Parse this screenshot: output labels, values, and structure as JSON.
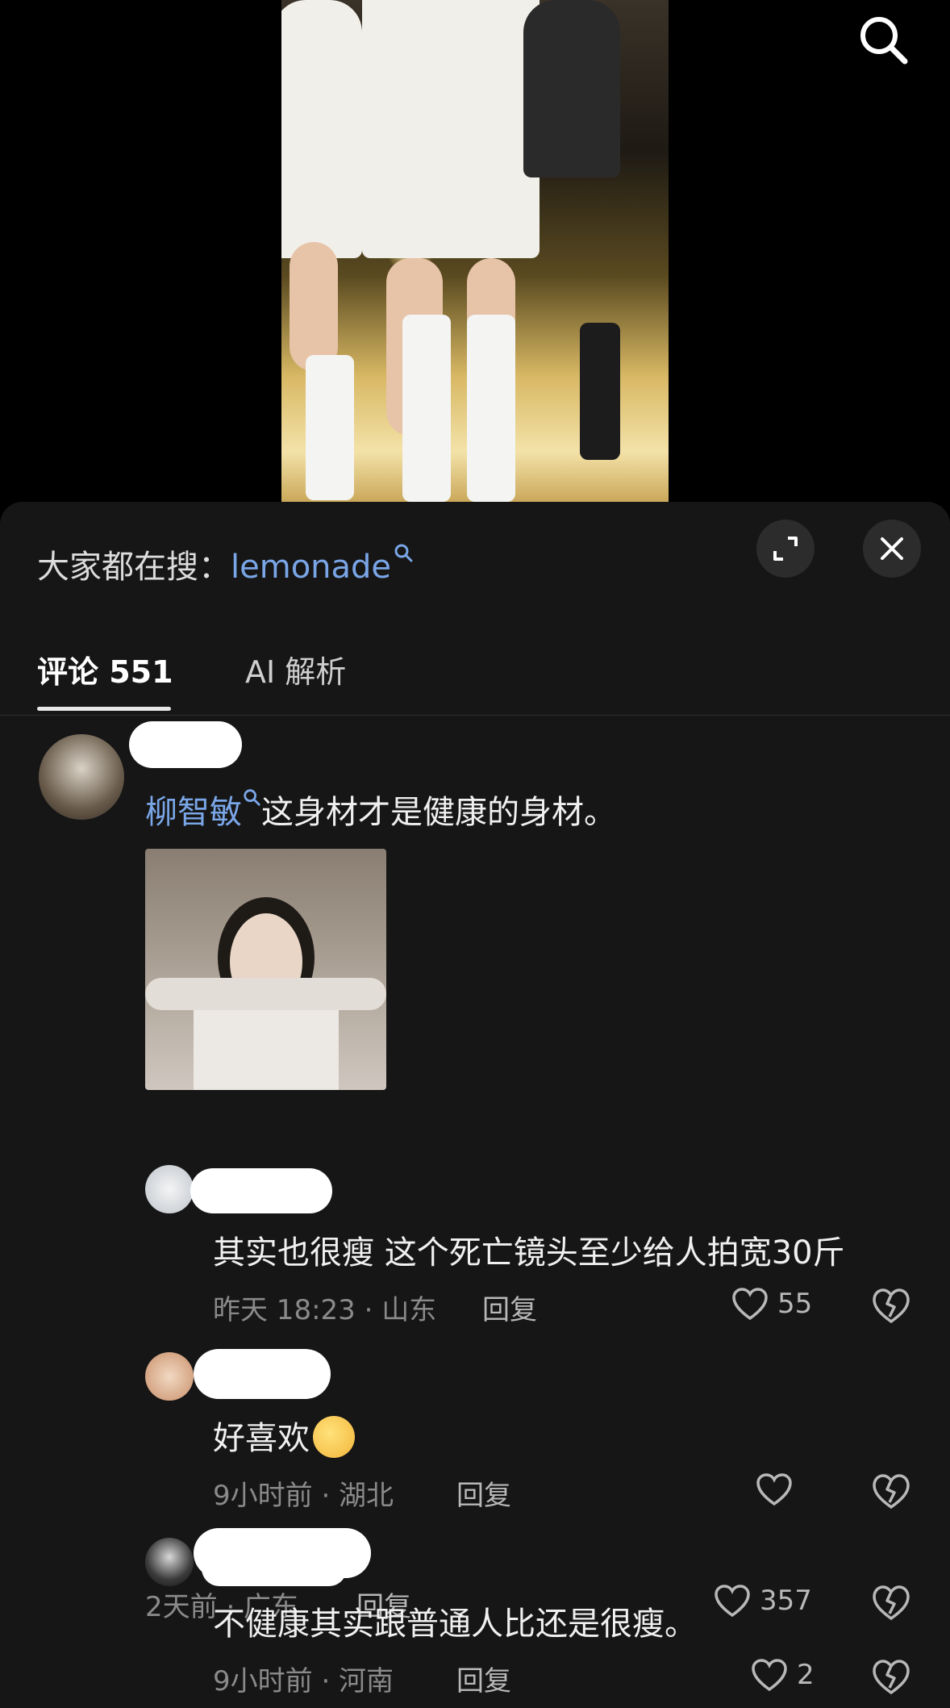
{
  "top_bar": {
    "search_icon": "search-icon"
  },
  "sheet": {
    "hot_search": {
      "label": "大家都在搜：",
      "keyword": "lemonade"
    },
    "expand_icon": "expand-icon",
    "close_icon": "close-icon",
    "tabs": [
      {
        "label": "评论 551",
        "active": true
      },
      {
        "label": "AI 解析",
        "active": false
      }
    ]
  },
  "comments": [
    {
      "mention": "柳智敏",
      "text": "这身材才是健康的身材。",
      "time": "2天前 · 广东",
      "reply": "回复",
      "likes": "357",
      "has_image": true
    }
  ],
  "replies": [
    {
      "text": "其实也很瘦 这个死亡镜头至少给人拍宽30斤",
      "time": "昨天 18:23 · 山东",
      "reply": "回复",
      "likes": "55"
    },
    {
      "text": "好喜欢",
      "time": "9小时前 · 湖北",
      "reply": "回复",
      "likes": ""
    },
    {
      "text": "不健康其实跟普通人比还是很瘦。",
      "time": "9小时前 · 河南",
      "reply": "回复",
      "likes": "2"
    }
  ],
  "colors": {
    "accent_link": "#7aa6e8",
    "sheet_bg": "#161616",
    "meta_text": "#8a8a8a"
  }
}
